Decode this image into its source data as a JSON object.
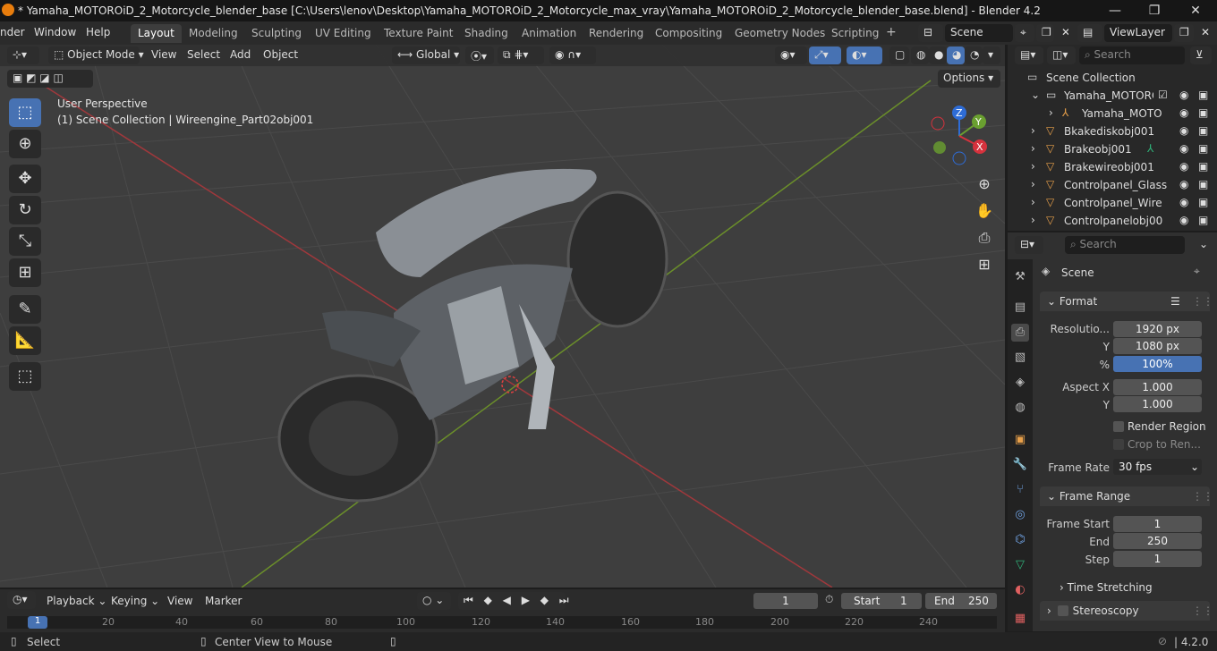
{
  "window": {
    "title": "* Yamaha_MOTOROiD_2_Motorcycle_blender_base [C:\\Users\\lenov\\Desktop\\Yamaha_MOTOROiD_2_Motorcycle_max_vray\\Yamaha_MOTOROiD_2_Motorcycle_blender_base.blend] - Blender 4.2",
    "minimize": "—",
    "maximize": "❐",
    "close": "✕"
  },
  "menubar": {
    "items": [
      "nder",
      "Window",
      "Help"
    ],
    "tabs": [
      "Layout",
      "Modeling",
      "Sculpting",
      "UV Editing",
      "Texture Paint",
      "Shading",
      "Animation",
      "Rendering",
      "Compositing",
      "Geometry Nodes",
      "Scripting"
    ],
    "add_tab": "+",
    "scene": "Scene",
    "view_layer": "ViewLayer"
  },
  "viewport_header": {
    "mode": "Object Mode",
    "menus": [
      "View",
      "Select",
      "Add",
      "Object"
    ],
    "orientation": "Global",
    "options": "Options"
  },
  "viewport": {
    "perspective": "User Perspective",
    "collection_info": "(1) Scene Collection | Wireengine_Part02obj001",
    "gizmo": {
      "z": "Z",
      "y": "Y",
      "x": "X"
    }
  },
  "outliner": {
    "search_placeholder": "Search",
    "root": "Scene Collection",
    "rows": [
      "Yamaha_MOTOROiI",
      "Yamaha_MOTO",
      "Bkakediskobj001",
      "Brakeobj001",
      "Brakewireobj001",
      "Controlpanel_Glass",
      "Controlpanel_Wire",
      "Controlpanelobj00"
    ]
  },
  "properties": {
    "search_placeholder": "Search",
    "context": "Scene",
    "format_panel": "Format",
    "resolution_label": "Resolutio...",
    "resolution_x": "1920 px",
    "y_label": "Y",
    "resolution_y": "1080 px",
    "percent_label": "%",
    "percent": "100%",
    "aspect_x_label": "Aspect X",
    "aspect_x": "1.000",
    "aspect_y": "1.000",
    "render_region": "Render Region",
    "crop": "Crop to Ren...",
    "frame_rate_label": "Frame Rate",
    "frame_rate": "30 fps",
    "frame_range_panel": "Frame Range",
    "frame_start_label": "Frame Start",
    "frame_start": "1",
    "end_label": "End",
    "end": "250",
    "step_label": "Step",
    "step": "1",
    "time_stretching": "Time Stretching",
    "stereoscopy": "Stereoscopy"
  },
  "timeline": {
    "menus": [
      "Playback",
      "Keying",
      "View",
      "Marker"
    ],
    "current_frame": "1",
    "start_label": "Start",
    "start": "1",
    "end_label": "End",
    "end": "250",
    "ticks": [
      "1",
      "20",
      "40",
      "60",
      "80",
      "100",
      "120",
      "140",
      "160",
      "180",
      "200",
      "220",
      "240"
    ]
  },
  "statusbar": {
    "select": "Select",
    "center_view": "Center View to Mouse",
    "version": "4.2.0"
  }
}
